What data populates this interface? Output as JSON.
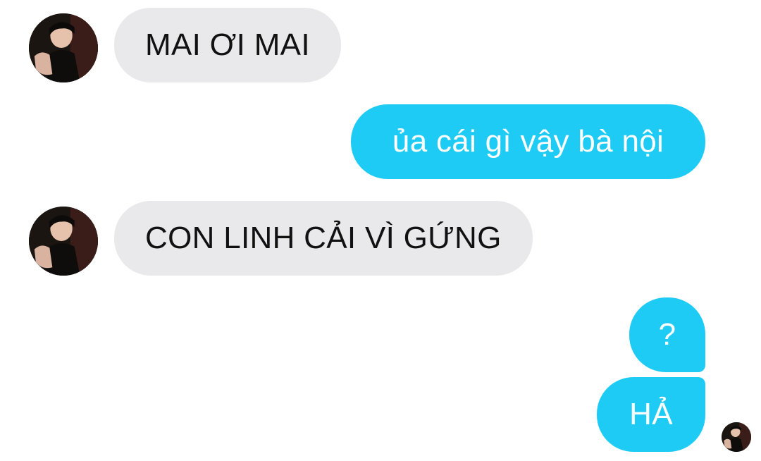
{
  "conversation": {
    "messages": [
      {
        "sender": "contact",
        "text": "MAI ƠI MAI"
      },
      {
        "sender": "me",
        "text": "ủa cái gì vậy bà nội"
      },
      {
        "sender": "contact",
        "text": "CON LINH CẢI VÌ GỨNG"
      },
      {
        "sender": "me",
        "text": "?"
      },
      {
        "sender": "me",
        "text": "HẢ"
      }
    ]
  },
  "colors": {
    "incoming_bubble": "#e9e9eb",
    "outgoing_bubble": "#1ecbf5",
    "background": "#ffffff"
  },
  "icons": {
    "contact_avatar": "profile-photo-icon",
    "seen_receipt": "read-receipt-avatar-icon"
  }
}
